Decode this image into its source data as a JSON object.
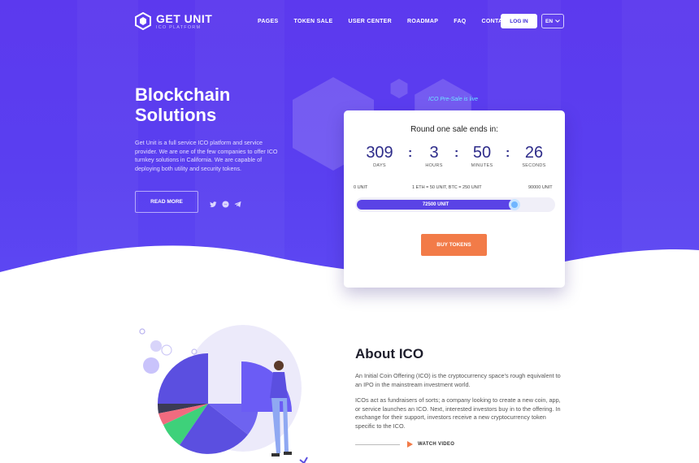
{
  "brand": {
    "name": "GET UNIT",
    "subtitle": "ICO PLATFORM"
  },
  "nav": {
    "items": [
      "PAGES",
      "TOKEN SALE",
      "USER CENTER",
      "ROADMAP",
      "FAQ",
      "CONTACTS"
    ],
    "login": "LOG IN",
    "language": "EN"
  },
  "hero": {
    "title_line1": "Blockchain",
    "title_line2": "Solutions",
    "description": "Get Unit is a full service ICO platform and service provider. We are one of the few companies to offer ICO turnkey solutions in California. We are capable of deploying both utility and security tokens.",
    "read_more": "READ MORE",
    "social": [
      "twitter-icon",
      "messenger-icon",
      "telegram-icon"
    ]
  },
  "sale": {
    "presale_note": "ICO Pre-Sale is live",
    "title": "Round one sale ends in:",
    "countdown": [
      {
        "value": "309",
        "label": "DAYS"
      },
      {
        "value": "3",
        "label": "HOURS"
      },
      {
        "value": "50",
        "label": "MINUTES"
      },
      {
        "value": "26",
        "label": "SECONDS"
      }
    ],
    "min_label": "0 UNIT",
    "rate_label": "1 ETH = 50 UNIT, BTC = 250 UNIT",
    "max_label": "90000 UNIT",
    "progress_label": "72500 UNIT",
    "progress_fraction": 0.8,
    "buy_label": "BUY TOKENS"
  },
  "about": {
    "title": "About ICO",
    "p1": "An Initial Coin Offering (ICO) is the cryptocurrency space's rough equivalent to an IPO in the mainstream investment world.",
    "p2": "ICOs act as fundraisers of sorts; a company looking to create a new coin, app, or service launches an ICO. Next, interested investors buy in to the offering. In exchange for their support, investors receive a new cryptocurrency token specific to the ICO.",
    "watch_video": "WATCH VIDEO"
  },
  "colors": {
    "primary": "#5c39ee",
    "accent": "#f27b48",
    "highlight": "#6ee3ff"
  }
}
